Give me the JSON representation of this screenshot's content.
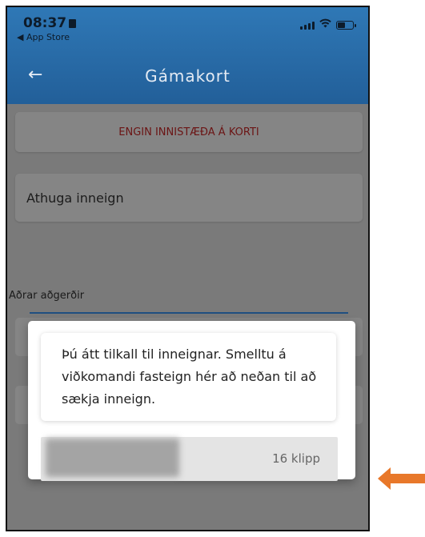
{
  "status_bar": {
    "time": "08:37",
    "back_app": "◀ App Store"
  },
  "nav": {
    "back_glyph": "←",
    "title": "Gámakort"
  },
  "balance_card": {
    "text": "ENGIN INNISTÆÐA Á KORTI"
  },
  "check_card": {
    "label": "Athuga inneign"
  },
  "other_actions": {
    "label": "Aðrar aðgerðir"
  },
  "modal": {
    "message": "Þú átt tilkall til inneignar. Smelltu á viðkomandi fasteign hér að neðan til að sækja inneign.",
    "property_row": {
      "count": "16 klipp"
    }
  },
  "colors": {
    "header_blue": "#2a6aa8",
    "accent_orange": "#e8782a",
    "warning_red": "#6b1414"
  },
  "icons": {
    "annotation": "arrow-left-icon"
  }
}
